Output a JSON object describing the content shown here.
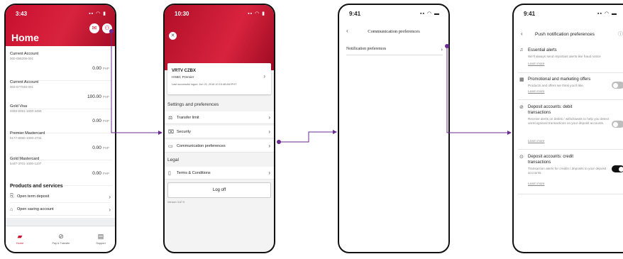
{
  "colors": {
    "brand_red": "#c8102e",
    "connector": "#6b2a8f",
    "toggle_on": "#111111",
    "toggle_off": "#bdbdbd"
  },
  "screen1": {
    "time": "3:43",
    "status_icons": "▪▪ ◠ ▮",
    "title": "Home",
    "header_icons": [
      "chat-icon",
      "profile-icon"
    ],
    "accounts": [
      {
        "name": "Current Account",
        "number": "000-056206-001",
        "amount": "0.00",
        "currency": "PHP"
      },
      {
        "name": "Current Account",
        "number": "003-577046-001",
        "amount": "100.00",
        "currency": "PHP"
      },
      {
        "name": "Gold Visa",
        "number": "4028-9391-1600-3455",
        "amount": "0.00",
        "currency": "PHP"
      },
      {
        "name": "Premier Mastercard",
        "number": "5177-8060-1000-4734",
        "amount": "0.00",
        "currency": "PHP"
      },
      {
        "name": "Gold Mastercard",
        "number": "5447-3701-1000-1107",
        "amount": "0.00",
        "currency": "PHP"
      }
    ],
    "products_heading": "Products and services",
    "products": [
      {
        "label": "Open term deposit",
        "icon": "deposit-icon"
      },
      {
        "label": "Open saving account",
        "icon": "bank-icon"
      }
    ],
    "tabs": [
      {
        "label": "Home",
        "icon": "home-icon"
      },
      {
        "label": "Pay & Transfer",
        "icon": "transfer-icon"
      },
      {
        "label": "Support",
        "icon": "support-icon"
      }
    ]
  },
  "screen2": {
    "time": "10:30",
    "status_icons": "▪▪ ◠ ▮",
    "profile_name": "VRTV CZBX",
    "profile_tier": "HSBC Premier",
    "last_login": "Last successful logon: Jun 21, 2018 10:15:48 AM PHT",
    "settings_heading": "Settings and preferences",
    "settings": [
      {
        "label": "Transfer limit",
        "icon": "scale-icon"
      },
      {
        "label": "Security",
        "icon": "lock-icon"
      },
      {
        "label": "Communication preferences",
        "icon": "message-icon"
      }
    ],
    "legal_heading": "Legal",
    "legal": [
      {
        "label": "Terms & Conditions",
        "icon": "document-icon"
      }
    ],
    "logoff_label": "Log off",
    "version": "Version 3.67.0"
  },
  "screen3": {
    "time": "9:41",
    "status_icons": "▪▪ ◠ ▬",
    "title": "Communication preferences",
    "rows": [
      {
        "label": "Notification preferences"
      }
    ]
  },
  "screen4": {
    "time": "9:41",
    "status_icons": "▪▪ ◠ ▬",
    "title": "Push notification preferences",
    "alerts": [
      {
        "title": "Essential alerts",
        "desc": "We'll always send important alerts like fraud notice",
        "link": "Learn more",
        "icon": "bell-icon",
        "toggle": null
      },
      {
        "title": "Promotional and marketing offers",
        "desc": "Products and offers we think you'll like.",
        "link": "Learn more",
        "icon": "gift-icon",
        "toggle": "off"
      },
      {
        "title": "Deposit accounts: debit transactions",
        "desc": "Receive alerts on debits / withdrawals to help you detect unrecognised transactions on your deposit accounts.",
        "link": "Learn more",
        "icon": "debit-icon",
        "toggle": "off"
      },
      {
        "title": "Deposit accounts: credit transactions",
        "desc": "Transaction alerts for credits / deposits to your deposit accounts.",
        "link": "Learn more",
        "icon": "credit-icon",
        "toggle": "on"
      }
    ]
  }
}
